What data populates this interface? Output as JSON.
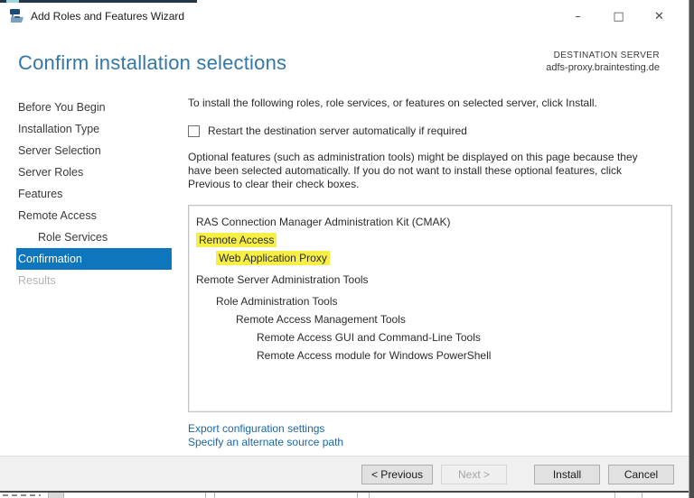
{
  "window": {
    "title": "Add Roles and Features Wizard",
    "controls": {
      "minimize": "–",
      "maximize": "□",
      "close": "✕"
    }
  },
  "header": {
    "title": "Confirm installation selections",
    "destination_label": "DESTINATION SERVER",
    "destination_server": "adfs-proxy.braintesting.de"
  },
  "sidebar": {
    "items": [
      {
        "label": "Before You Begin",
        "state": "enabled"
      },
      {
        "label": "Installation Type",
        "state": "enabled"
      },
      {
        "label": "Server Selection",
        "state": "enabled"
      },
      {
        "label": "Server Roles",
        "state": "enabled"
      },
      {
        "label": "Features",
        "state": "enabled"
      },
      {
        "label": "Remote Access",
        "state": "enabled"
      },
      {
        "label": "Role Services",
        "state": "enabled",
        "indent": 1
      },
      {
        "label": "Confirmation",
        "state": "selected"
      },
      {
        "label": "Results",
        "state": "disabled"
      }
    ]
  },
  "content": {
    "intro": "To install the following roles, role services, or features on selected server, click Install.",
    "restart_checkbox": {
      "label": "Restart the destination server automatically if required",
      "checked": false
    },
    "optional_note": "Optional features (such as administration tools) might be displayed on this page because they have been selected automatically. If you do not want to install these optional features, click Previous to clear their check boxes.",
    "selection_tree": [
      {
        "label": "RAS Connection Manager Administration Kit (CMAK)",
        "indent": 0,
        "highlight": false
      },
      {
        "label": "Remote Access",
        "indent": 0,
        "highlight": true
      },
      {
        "label": "Web Application Proxy",
        "indent": 1,
        "highlight": true
      },
      {
        "label": "Remote Server Administration Tools",
        "indent": 0,
        "highlight": false
      },
      {
        "label": "Role Administration Tools",
        "indent": 1,
        "highlight": false
      },
      {
        "label": "Remote Access Management Tools",
        "indent": 2,
        "highlight": false
      },
      {
        "label": "Remote Access GUI and Command-Line Tools",
        "indent": 3,
        "highlight": false
      },
      {
        "label": "Remote Access module for Windows PowerShell",
        "indent": 3,
        "highlight": false
      }
    ],
    "links": [
      {
        "label": "Export configuration settings"
      },
      {
        "label": "Specify an alternate source path"
      }
    ]
  },
  "footer": {
    "buttons": [
      {
        "label": "< Previous",
        "enabled": true
      },
      {
        "label": "Next >",
        "enabled": false
      },
      {
        "label": "Install",
        "enabled": true
      },
      {
        "label": "Cancel",
        "enabled": true
      }
    ]
  },
  "colors": {
    "accent_heading": "#3376a9",
    "nav_selected_bg": "#0e76bd",
    "link": "#1a66a8",
    "highlight_yellow": "#f7ef45",
    "footer_bg": "#f0f0f0",
    "button_bg": "#e1e1e1"
  }
}
